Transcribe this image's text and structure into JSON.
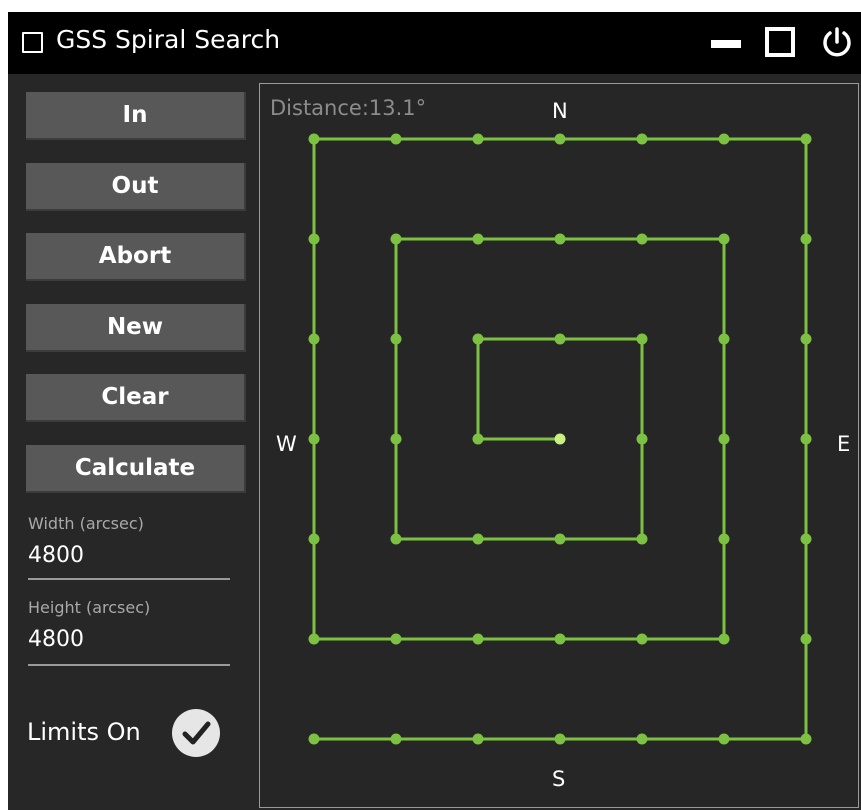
{
  "window": {
    "title": "GSS Spiral Search"
  },
  "buttons": {
    "in": "In",
    "out": "Out",
    "abort": "Abort",
    "new": "New",
    "clear": "Clear",
    "calculate": "Calculate"
  },
  "fields": {
    "width": {
      "label": "Width (arcsec)",
      "value": "4800"
    },
    "height": {
      "label": "Height (arcsec)",
      "value": "4800"
    }
  },
  "limits": {
    "label": "Limits On",
    "checked": true
  },
  "plot": {
    "distance": "Distance:13.1°",
    "compass": {
      "north": "N",
      "south": "S",
      "east": "E",
      "west": "W"
    },
    "path_color": "#7cc142",
    "current_point_color": "#c8f082"
  },
  "icons": {
    "window_checkbox": "checkbox-icon",
    "minimize": "minimize-icon",
    "maximize": "maximize-icon",
    "close": "power-icon",
    "limits_check": "checkmark-icon"
  }
}
